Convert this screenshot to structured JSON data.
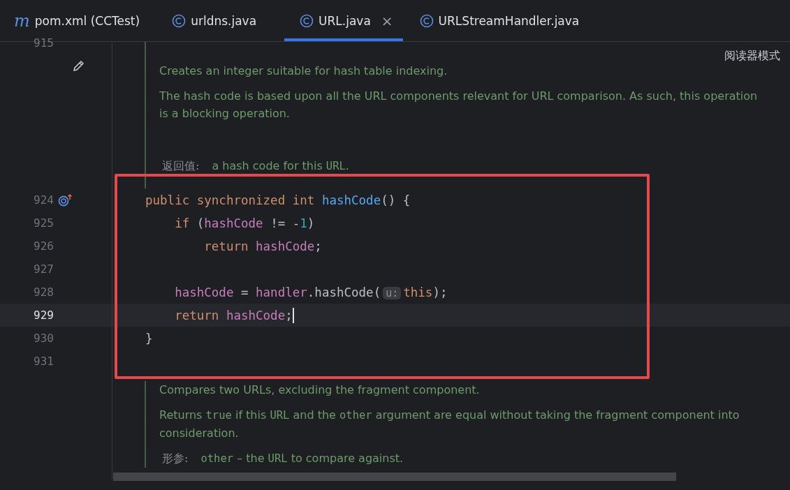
{
  "tabs": [
    {
      "label": "pom.xml (CCTest)",
      "kind": "maven",
      "icon_text": "m",
      "selected": false
    },
    {
      "label": "urldns.java",
      "kind": "class",
      "selected": false
    },
    {
      "label": "URL.java",
      "kind": "class",
      "selected": true,
      "close": "×"
    },
    {
      "label": "URLStreamHandler.java",
      "kind": "class",
      "selected": false
    }
  ],
  "reader_mode": "阅读器模式",
  "top_line_number": "915",
  "doc_before": {
    "paragraphs": [
      [
        {
          "text": "Creates an integer suitable for hash table indexing.",
          "kind": "text"
        }
      ],
      [
        {
          "text": "The hash code is based upon all the URL components relevant for URL comparison. As such, this operation is a blocking operation.",
          "kind": "text"
        }
      ]
    ],
    "tags": [
      {
        "label": "返回值:",
        "parts": [
          {
            "text": "a hash code for this ",
            "kind": "text"
          },
          {
            "text": "URL",
            "kind": "code"
          },
          {
            "text": ".",
            "kind": "text"
          }
        ]
      }
    ]
  },
  "code_lines": [
    {
      "number": "924",
      "current": false,
      "override": true,
      "tokens": [
        {
          "text": "public synchronized int ",
          "kind": "keyword"
        },
        {
          "text": "hashCode",
          "kind": "method"
        },
        {
          "text": "() {",
          "kind": "plain"
        }
      ]
    },
    {
      "number": "925",
      "current": false,
      "override": false,
      "tokens": [
        {
          "text": "    if ",
          "kind": "keyword"
        },
        {
          "text": "(",
          "kind": "plain"
        },
        {
          "text": "hashCode",
          "kind": "field"
        },
        {
          "text": " != -",
          "kind": "plain"
        },
        {
          "text": "1",
          "kind": "number"
        },
        {
          "text": ")",
          "kind": "plain"
        }
      ]
    },
    {
      "number": "926",
      "current": false,
      "override": false,
      "tokens": [
        {
          "text": "        return ",
          "kind": "keyword"
        },
        {
          "text": "hashCode",
          "kind": "field"
        },
        {
          "text": ";",
          "kind": "plain"
        }
      ]
    },
    {
      "number": "927",
      "current": false,
      "override": false
    },
    {
      "number": "928",
      "current": false,
      "override": false,
      "tokens": [
        {
          "text": "    hashCode",
          "kind": "field"
        },
        {
          "text": " = ",
          "kind": "plain"
        },
        {
          "text": "handler",
          "kind": "field"
        },
        {
          "text": ".hashCode(",
          "kind": "plain"
        },
        {
          "text": "u:",
          "kind": "hint"
        },
        {
          "text": "this",
          "kind": "keyword"
        },
        {
          "text": ");",
          "kind": "plain"
        }
      ]
    },
    {
      "number": "929",
      "current": true,
      "override": false,
      "tokens": [
        {
          "text": "    return ",
          "kind": "keyword"
        },
        {
          "text": "hashCode",
          "kind": "field"
        },
        {
          "text": ";",
          "kind": "plain"
        }
      ]
    },
    {
      "number": "930",
      "current": false,
      "override": false,
      "tokens": [
        {
          "text": "}",
          "kind": "plain"
        }
      ]
    },
    {
      "number": "931",
      "current": false,
      "override": false
    }
  ],
  "doc_after": {
    "paragraphs": [
      [
        {
          "text": "Compares two URLs, excluding the fragment component.",
          "kind": "text"
        }
      ],
      [
        {
          "text": "Returns ",
          "kind": "text"
        },
        {
          "text": "true",
          "kind": "code"
        },
        {
          "text": " if this ",
          "kind": "text"
        },
        {
          "text": "URL",
          "kind": "code"
        },
        {
          "text": " and the ",
          "kind": "text"
        },
        {
          "text": "other",
          "kind": "code"
        },
        {
          "text": " argument are equal without taking the fragment component into consideration.",
          "kind": "text"
        }
      ]
    ],
    "tags": [
      {
        "label": "形参:",
        "parts": [
          {
            "text": "other",
            "kind": "code"
          },
          {
            "text": " – the ",
            "kind": "text"
          },
          {
            "text": "URL",
            "kind": "code"
          },
          {
            "text": " to compare against.",
            "kind": "text"
          }
        ]
      }
    ]
  }
}
